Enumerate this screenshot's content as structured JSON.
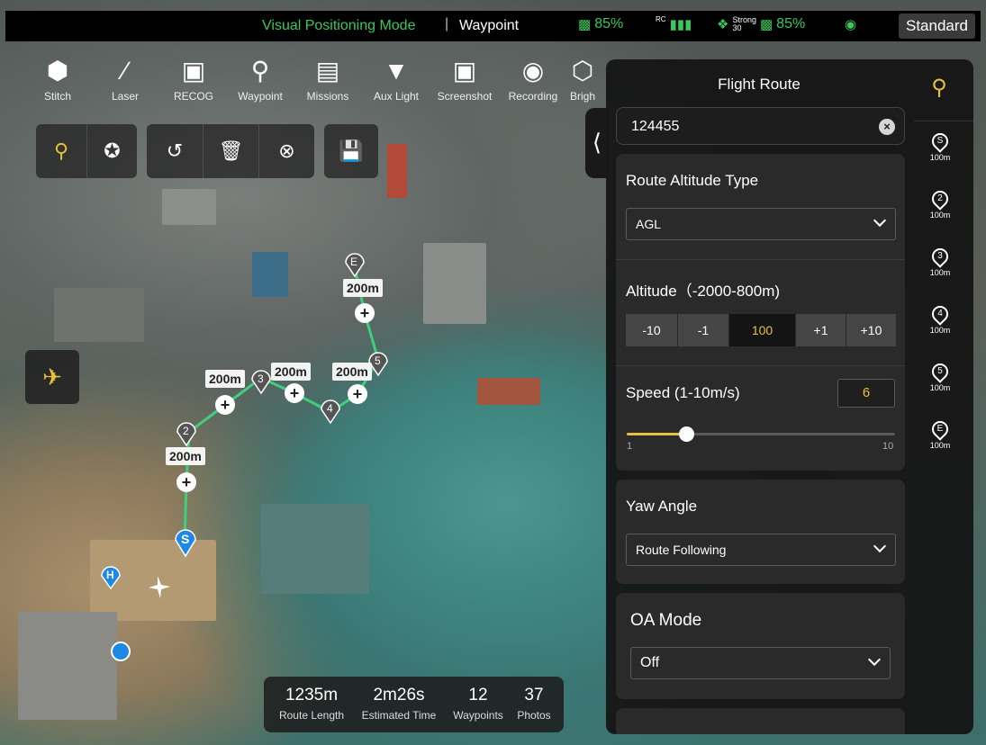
{
  "status_bar": {
    "mode": "Visual Positioning Mode",
    "separator": "|",
    "mission": "Waypoint",
    "battery_drone": "85%",
    "rc_label": "RC",
    "signal_label": "Strong",
    "signal_value": "30",
    "battery_rc": "85%",
    "profile": "Standard"
  },
  "toolbar": [
    {
      "label": "Stitch",
      "icon": "stitch-icon"
    },
    {
      "label": "Laser",
      "icon": "laser-icon"
    },
    {
      "label": "RECOG",
      "icon": "recog-icon"
    },
    {
      "label": "Waypoint",
      "icon": "waypoint-icon"
    },
    {
      "label": "Missions",
      "icon": "missions-icon"
    },
    {
      "label": "Aux Light",
      "icon": "aux-light-icon"
    },
    {
      "label": "Screenshot",
      "icon": "screenshot-icon"
    },
    {
      "label": "Recording",
      "icon": "recording-icon"
    },
    {
      "label": "Brigh",
      "icon": "brightness-icon"
    }
  ],
  "map_markers": {
    "start": "S",
    "end": "E",
    "waypoints": [
      "2",
      "3",
      "4",
      "5"
    ],
    "segment_distance": "200m",
    "heliport": "H"
  },
  "stats": {
    "route_length": "1235m",
    "route_length_label": "Route Length",
    "estimated_time": "2m26s",
    "estimated_time_label": "Estimated Time",
    "waypoints": "12",
    "waypoints_label": "Waypoints",
    "photos": "37",
    "photos_label": "Photos"
  },
  "panel": {
    "title": "Flight Route",
    "route_name": "124455",
    "altitude_type_title": "Route Altitude Type",
    "altitude_type_value": "AGL",
    "altitude_title": "Altitude（-2000-800m)",
    "altitude_buttons": [
      "-10",
      "-1",
      "100",
      "+1",
      "+10"
    ],
    "speed_title": "Speed (1-10m/s)",
    "speed_value": "6",
    "speed_min": "1",
    "speed_max": "10",
    "speed_fraction": 0.22,
    "yaw_title": "Yaw Angle",
    "yaw_value": "Route Following",
    "oa_title": "OA Mode",
    "oa_value": "Off"
  },
  "waypoint_list": [
    {
      "label": "S",
      "alt": "100m"
    },
    {
      "label": "2",
      "alt": "100m"
    },
    {
      "label": "3",
      "alt": "100m"
    },
    {
      "label": "4",
      "alt": "100m"
    },
    {
      "label": "5",
      "alt": "100m"
    },
    {
      "label": "E",
      "alt": "100m"
    }
  ],
  "colors": {
    "accent": "#e8c13a",
    "route_line": "#3fd07c",
    "status_green": "#38c95a",
    "start_marker": "#1e88e5"
  }
}
